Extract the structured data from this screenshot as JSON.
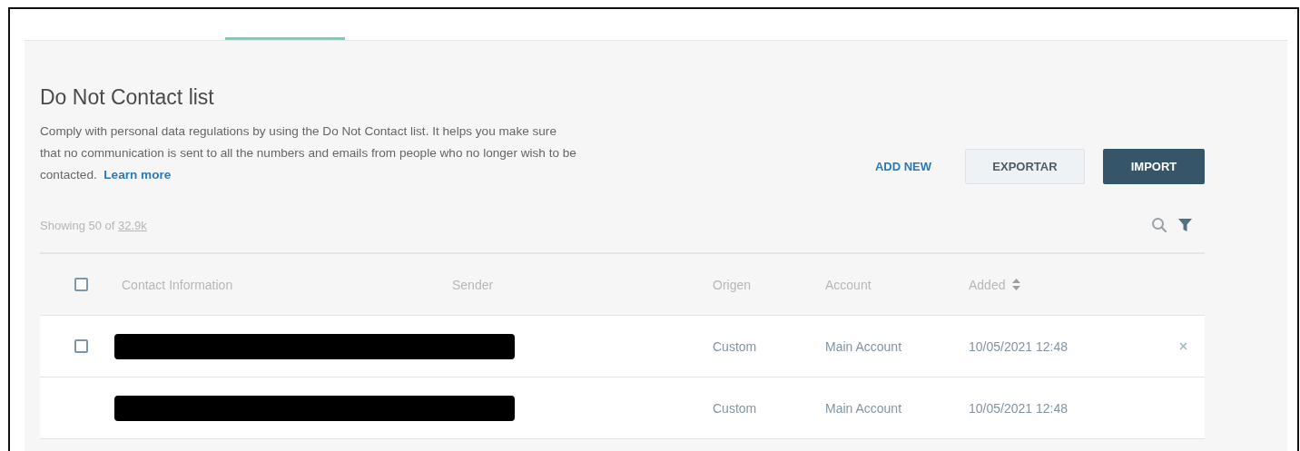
{
  "tabs": [
    {
      "selected": false
    },
    {
      "selected": true
    },
    {
      "selected": false
    }
  ],
  "title": "Do Not Contact list",
  "description": {
    "text": "Comply with personal data regulations by using the Do Not Contact list. It helps you make sure that no communication is sent to all the numbers and emails from people who no longer wish to be contacted.",
    "link": "Learn more"
  },
  "actions": [
    {
      "label": "ADD NEW",
      "kind": "link"
    },
    {
      "label": "EXPORTAR",
      "kind": "secondary"
    },
    {
      "label": "IMPORT",
      "kind": "primary"
    }
  ],
  "summary": {
    "prefix": "Showing 50 of",
    "total": "32.9k"
  },
  "table": {
    "select_all": {
      "checked": false
    },
    "columns": [
      {
        "label": "Contact Information"
      },
      {
        "label": "Sender"
      },
      {
        "label": "Origen"
      },
      {
        "label": "Account"
      },
      {
        "label": "Added",
        "sortable": true
      }
    ],
    "rows": [
      {
        "redacted": true,
        "hovered": true,
        "checked": false,
        "origin": "Custom",
        "account": "Main Account",
        "added": "10/05/2021 12:48"
      },
      {
        "redacted": true,
        "hovered": false,
        "checked": false,
        "origin": "Custom",
        "account": "Main Account",
        "added": "10/05/2021 12:48"
      }
    ]
  }
}
